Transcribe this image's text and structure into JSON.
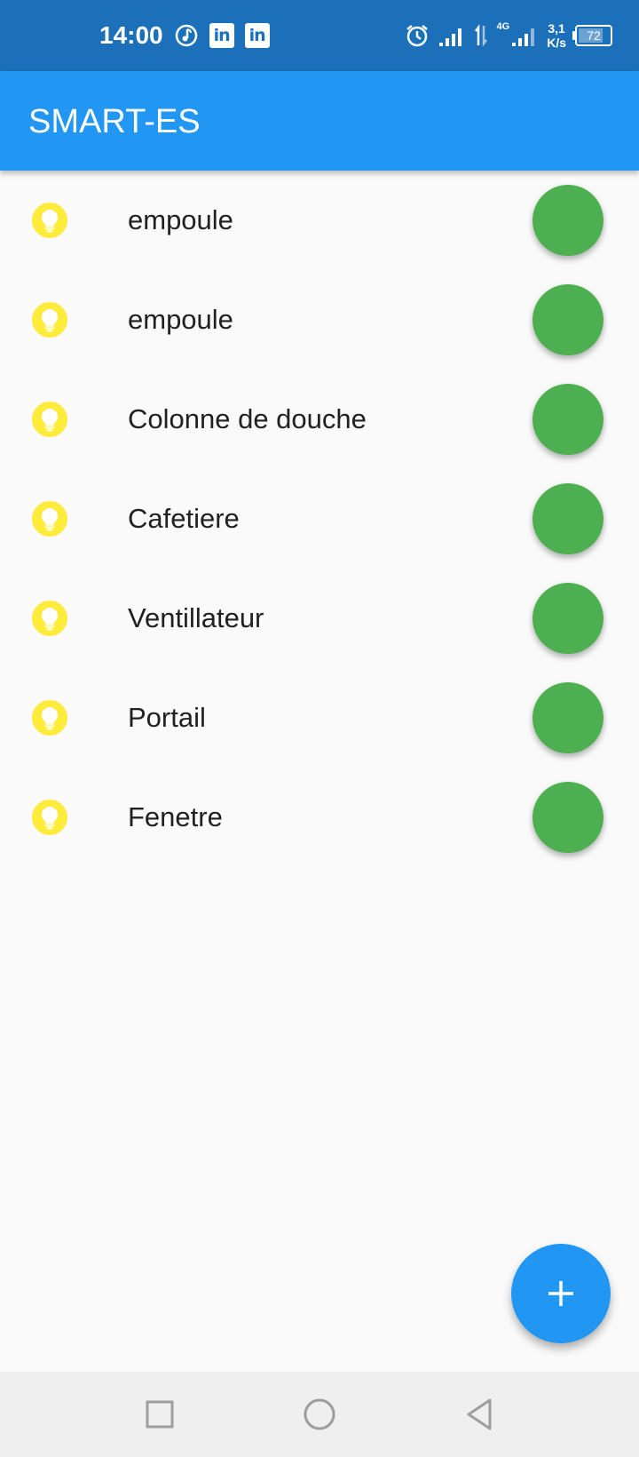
{
  "status_bar": {
    "time": "14:00",
    "icons_left": [
      "music-icon",
      "linkedin-icon",
      "linkedin-icon"
    ],
    "linkedin_text": "in",
    "network_type": "4G",
    "net_speed_value": "3,1",
    "net_speed_unit": "K/s",
    "battery_level": "72",
    "battery_fraction": 0.72,
    "color": "#1b70b9"
  },
  "app_bar": {
    "title": "SMART-ES",
    "color": "#2196f3"
  },
  "devices": [
    {
      "name": "empoule",
      "icon": "lightbulb-icon"
    },
    {
      "name": "empoule",
      "icon": "lightbulb-icon"
    },
    {
      "name": "Colonne de douche",
      "icon": "lightbulb-icon"
    },
    {
      "name": "Cafetiere",
      "icon": "lightbulb-icon"
    },
    {
      "name": "Ventillateur",
      "icon": "lightbulb-icon"
    },
    {
      "name": "Portail",
      "icon": "lightbulb-icon"
    },
    {
      "name": "Fenetre",
      "icon": "lightbulb-icon"
    }
  ],
  "colors": {
    "toggle_on": "#4caf50",
    "bulb": "#ffeb3b",
    "fab": "#2196f3"
  },
  "fab": {
    "icon": "plus-icon"
  },
  "nav_bar": {
    "buttons": [
      "recent-apps-icon",
      "home-icon",
      "back-icon"
    ]
  }
}
